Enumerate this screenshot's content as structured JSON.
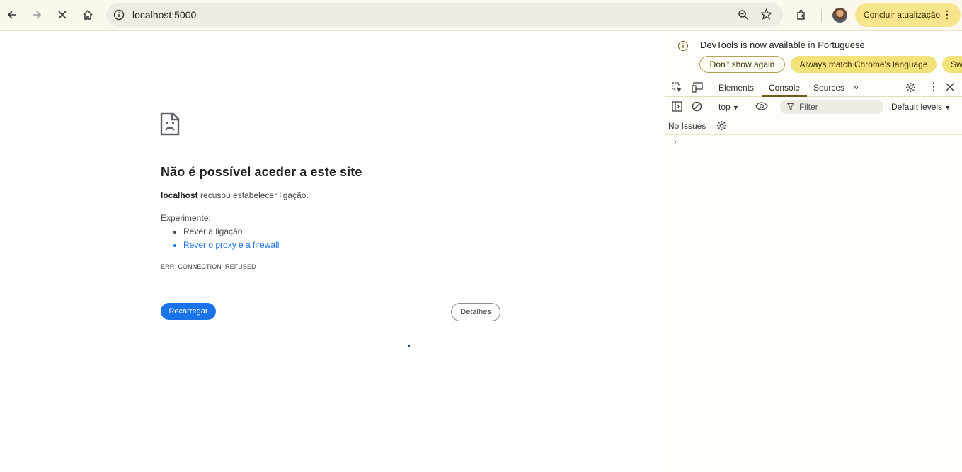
{
  "browser": {
    "url": "localhost:5000",
    "update_label": "Concluir atualização"
  },
  "error_page": {
    "title": "Não é possível aceder a este site",
    "host": "localhost",
    "message": "recusou estabelecer ligação.",
    "try_label": "Experimente:",
    "suggestions": [
      "Rever a ligação",
      "Rever o proxy e a firewall"
    ],
    "error_code": "ERR_CONNECTION_REFUSED",
    "reload_label": "Recarregar",
    "details_label": "Detalhes"
  },
  "devtools": {
    "info_message": "DevTools is now available in Portuguese",
    "buttons": [
      "Don't show again",
      "Always match Chrome's language",
      "Swi"
    ],
    "tabs": [
      "Elements",
      "Console",
      "Sources"
    ],
    "active_tab": "Console",
    "context": "top",
    "filter_placeholder": "Filter",
    "levels": "Default levels",
    "issues": "No Issues"
  },
  "colors": {
    "accent": "#1a73e8",
    "update_pill": "#f6e58d",
    "lang_button": "#f2e27a"
  }
}
